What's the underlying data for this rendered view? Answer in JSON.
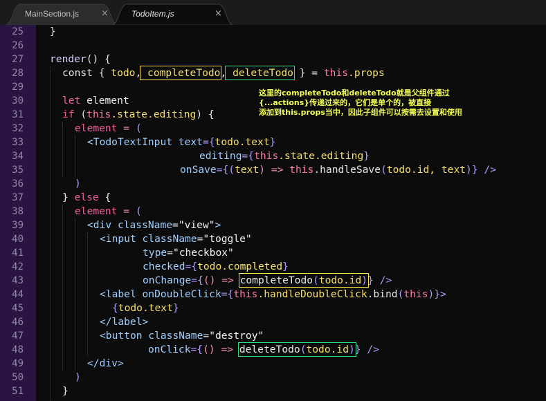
{
  "tabs": [
    {
      "label": "MainSection.js",
      "close": "×",
      "active": false
    },
    {
      "label": "TodoItem.js",
      "close": "×",
      "active": true
    }
  ],
  "line_numbers": [
    "25",
    "26",
    "27",
    "28",
    "29",
    "30",
    "31",
    "32",
    "33",
    "34",
    "35",
    "36",
    "37",
    "38",
    "39",
    "40",
    "41",
    "42",
    "43",
    "44",
    "45",
    "46",
    "47",
    "48",
    "49",
    "50",
    "51"
  ],
  "code": {
    "l25": [
      "}"
    ],
    "l27": [
      "render",
      "() {"
    ],
    "l28": [
      "const",
      " { ",
      "todo",
      ",",
      " completeTodo",
      ",",
      " deleteTodo",
      " } = ",
      "this",
      ".props"
    ],
    "l30": [
      "let",
      " element"
    ],
    "l31": [
      "if",
      " (",
      "this",
      ".state.editing",
      ") {"
    ],
    "l32": [
      "element",
      " = ",
      "("
    ],
    "l33": [
      "<",
      "TodoTextInput",
      " text",
      "={",
      "todo",
      ".text",
      "}"
    ],
    "l34": [
      "editing",
      "={",
      "this",
      ".state.editing",
      "}"
    ],
    "l35": [
      "onSave",
      "={",
      "(",
      "text",
      ") => ",
      "this",
      ".handleSave",
      "(",
      "todo",
      ".id, ",
      "text",
      ")} />"
    ],
    "l36": [
      ")"
    ],
    "l37": [
      "} ",
      "else",
      " {"
    ],
    "l38": [
      "element",
      " = ",
      "("
    ],
    "l39": [
      "<",
      "div",
      " className",
      "=",
      "\"view\"",
      ">"
    ],
    "l40": [
      "<",
      "input",
      " className",
      "=",
      "\"toggle\""
    ],
    "l41": [
      "type",
      "=",
      "\"checkbox\""
    ],
    "l42": [
      "checked",
      "={",
      "todo",
      ".completed",
      "}"
    ],
    "l43": [
      "onChange",
      "={",
      "() => ",
      "completeTodo",
      "(",
      "todo",
      ".id",
      ")",
      "} />"
    ],
    "l44": [
      "<",
      "label",
      " onDoubleClick",
      "={",
      "this",
      ".handleDoubleClick",
      ".bind",
      "(",
      "this",
      ")}>"
    ],
    "l45": [
      "{",
      "todo",
      ".text",
      "}"
    ],
    "l46": [
      "</",
      "label",
      ">"
    ],
    "l47": [
      "<",
      "button",
      " className",
      "=",
      "\"destroy\""
    ],
    "l48": [
      "onClick",
      "={",
      "() => ",
      "deleteTodo",
      "(",
      "todo",
      ".id",
      ")",
      "} />"
    ],
    "l49": [
      "</",
      "div",
      ">"
    ],
    "l50": [
      ")"
    ],
    "l51": [
      "}"
    ]
  },
  "annotation": {
    "line1": "这里的completeTodo和deleteTodo就是父组件通过",
    "line2": "{...actions}传递过来的，它们是单个的，被直接",
    "line3": "添加到this.props当中，因此子组件可以按需去设置和使用"
  },
  "colors": {
    "highlight_yellow": "#ffe34a",
    "highlight_green": "#33e08a",
    "annotation_text": "#f3ff55",
    "gutter": "#2a1542",
    "keyword": "#f05c9e"
  }
}
